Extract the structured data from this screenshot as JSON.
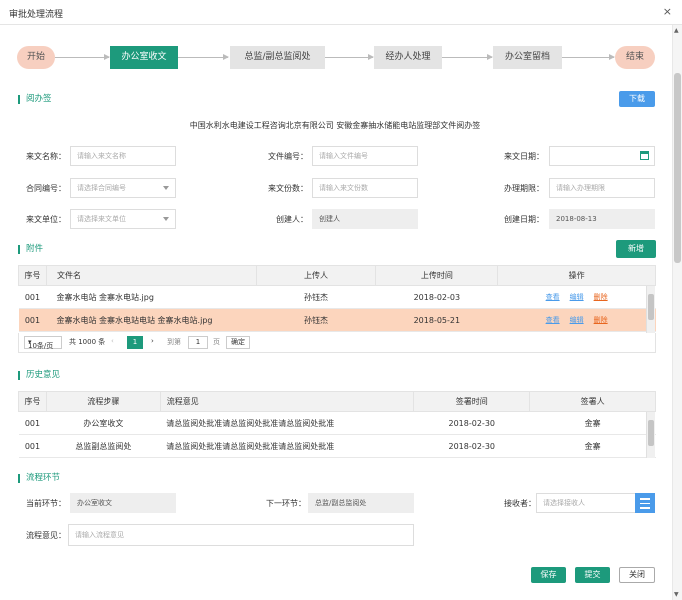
{
  "window": {
    "title": "审批处理流程",
    "close": "×"
  },
  "steps": [
    "开始",
    "办公室收文",
    "总监/副总监阅处",
    "经办人处理",
    "办公室留档",
    "结束"
  ],
  "read": {
    "section": "阅办签",
    "download": "下载",
    "doc_title": "中国水利水电建设工程咨询北京有限公司 安徽金寨抽水储能电站监理部文件阅办签"
  },
  "form": {
    "from_name": {
      "label": "来文名称：",
      "placeholder": "请输入来文名称"
    },
    "doc_no": {
      "label": "文件编号：",
      "placeholder": "请输入文件编号"
    },
    "from_date": {
      "label": "来文日期：",
      "placeholder": ""
    },
    "contract_no": {
      "label": "合同编号：",
      "placeholder": "请选择合同编号"
    },
    "copies": {
      "label": "来文份数：",
      "placeholder": "请输入来文份数"
    },
    "deadline": {
      "label": "办理期限：",
      "placeholder": "请输入办理期限"
    },
    "unit": {
      "label": "来文单位：",
      "placeholder": "请选择来文单位"
    },
    "creator": {
      "label": "创建人：",
      "value": "创建人"
    },
    "created": {
      "label": "创建日期：",
      "value": "2018-08-13"
    }
  },
  "attachments": {
    "section": "附件",
    "add": "新增",
    "headers": [
      "序号",
      "文件名",
      "上传人",
      "上传时间",
      "操作"
    ],
    "rows": [
      {
        "no": "001",
        "name": "金寨水电站 金寨水电站.jpg",
        "uploader": "孙钰杰",
        "time": "2018-02-03"
      },
      {
        "no": "001",
        "name": "金寨水电站 金寨水电站电站 金寨水电站.jpg",
        "uploader": "孙钰杰",
        "time": "2018-05-21"
      }
    ],
    "ops": {
      "view": "查看",
      "edit": "编辑",
      "del": "删除"
    },
    "pager": {
      "size": "10条/页",
      "total": "共 1000 条",
      "page": "1",
      "goto": "到第",
      "input": "1",
      "unit": "页",
      "ok": "确定"
    }
  },
  "history": {
    "section": "历史意见",
    "headers": [
      "序号",
      "流程步骤",
      "流程意见",
      "签署时间",
      "签署人"
    ],
    "rows": [
      {
        "no": "001",
        "step": "办公室收文",
        "opinion": "请总监阅处批准请总监阅处批准请总监阅处批准",
        "time": "2018-02-30",
        "signer": "金寨"
      },
      {
        "no": "001",
        "step": "总监副总监阅处",
        "opinion": "请总监阅处批准请总监阅处批准请总监阅处批准",
        "time": "2018-02-30",
        "signer": "金寨"
      }
    ]
  },
  "flow": {
    "section": "流程环节",
    "current": {
      "label": "当前环节：",
      "value": "办公室收文"
    },
    "next": {
      "label": "下一环节：",
      "value": "总监/副总监阅处"
    },
    "receiver": {
      "label": "接收者：",
      "placeholder": "请选择接收人"
    },
    "opinion": {
      "label": "流程意见：",
      "placeholder": "请输入流程意见"
    }
  },
  "actions": {
    "save": "保存",
    "submit": "提交",
    "close": "关闭"
  }
}
